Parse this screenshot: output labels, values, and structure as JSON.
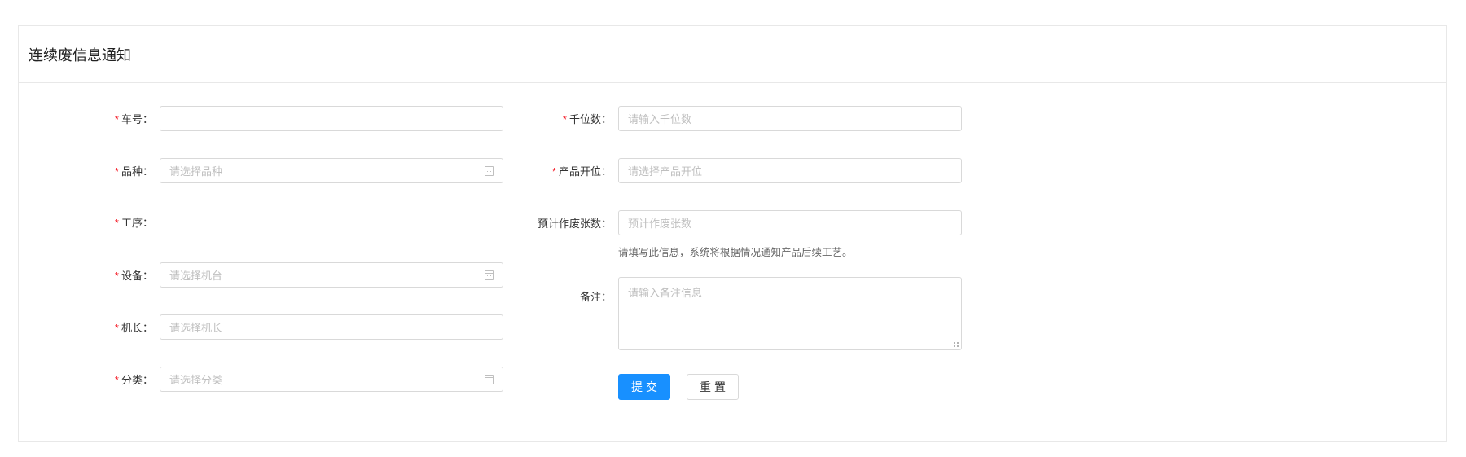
{
  "card": {
    "title": "连续废信息通知"
  },
  "left": [
    {
      "label": "车号",
      "required": "*",
      "value": "",
      "placeholder": ""
    },
    {
      "label": "品种",
      "required": "*",
      "placeholder": "请选择品种",
      "icon": "calendar-icon"
    },
    {
      "label": "工序",
      "required": "*"
    },
    {
      "label": "设备",
      "required": "*",
      "placeholder": "请选择机台",
      "icon": "calendar-icon"
    },
    {
      "label": "机长",
      "required": "*",
      "placeholder": "请选择机长"
    },
    {
      "label": "分类",
      "required": "*",
      "placeholder": "请选择分类",
      "icon": "calendar-icon"
    }
  ],
  "right": [
    {
      "label": "千位数",
      "required": "*",
      "placeholder": "请输入千位数"
    },
    {
      "label": "产品开位",
      "required": "*",
      "placeholder": "请选择产品开位"
    },
    {
      "label": "预计作废张数",
      "placeholder": "预计作废张数",
      "help": "请填写此信息，系统将根据情况通知产品后续工艺。"
    },
    {
      "label": "备注",
      "placeholder": "请输入备注信息"
    }
  ],
  "colon": "：",
  "buttons": {
    "submit": "提交",
    "reset": "重置"
  },
  "colors": {
    "primary": "#1890ff",
    "required": "#f5222d",
    "border": "#d9d9d9"
  }
}
